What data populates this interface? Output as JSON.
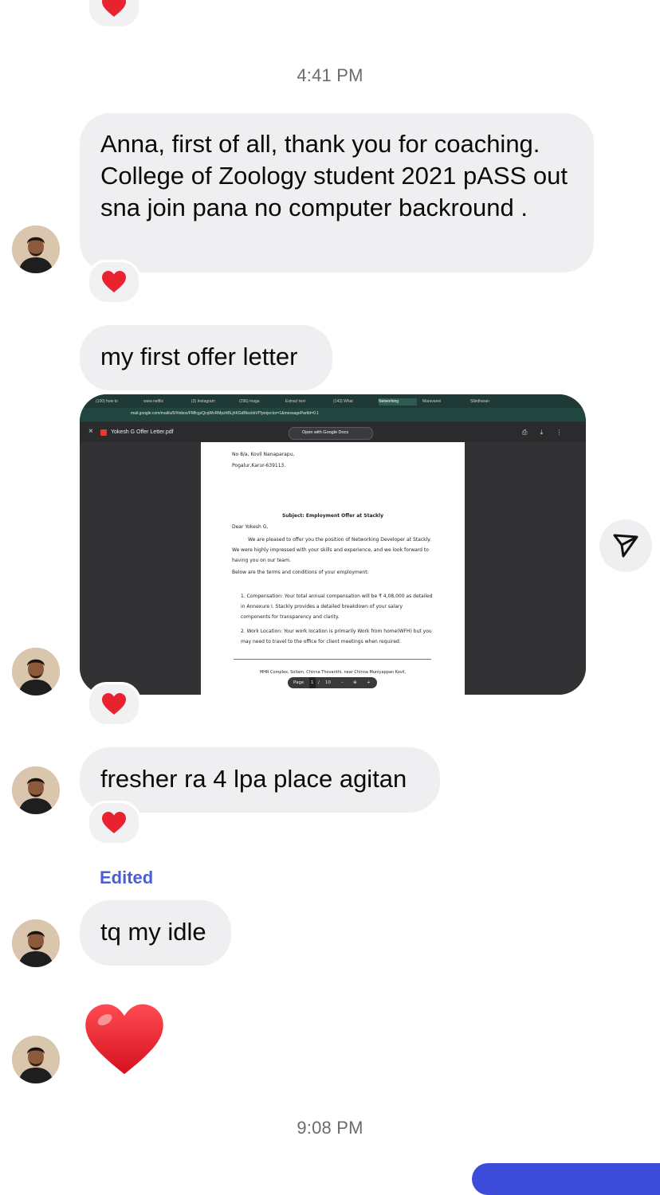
{
  "timestamps": [
    "4:41 PM",
    "9:08 PM"
  ],
  "messages": {
    "coaching": "Anna, first of all, thank you for coaching. College of Zoology student 2021 pASS out sna join pana no computer backround .",
    "offer": "my first offer letter",
    "fresher": "fresher ra 4 lpa place agitan",
    "edited_label": "Edited",
    "tq": "tq my idle"
  },
  "reaction_icon": "red-heart",
  "screenshot": {
    "url": "mail.google.com/mail/u/0/#inbox/FMfcgzQcqWvRMpzhBLjhKGdlNsckbVf?projector=1&messagePartId=0.1",
    "file_name": "Yokesh G Offer Letter.pdf",
    "open_with": "Open with Google Docs",
    "address_1": "No 8/a, Kovil Nanaparapu,",
    "address_2": "Pogalur,Karur-639113.",
    "subject": "Subject: Employment Offer at Stackly",
    "greeting": "Dear Yokesh G,",
    "para_1": "We are pleased to offer you the position of Networking Developer at Stackly. We were highly impressed with your skills and experience, and we look forward to having you on our team.",
    "para_2": "Below are the terms and conditions of your employment:",
    "item_1": "1. Compensation: Your total annual compensation will be ₹ 4,08,000 as detailed in Annexure I. Stackly provides a detailed breakdown of your salary components for transparency and clarity.",
    "item_2": "2. Work Location: Your work location is primarily Work from home(WFH) but you may need to travel to the office for client meetings when required.",
    "footer": "MHR Complex, Sollam, Chinna Thovanthi, near Chinna Muniyappan Kovil,",
    "page_label": "Page",
    "page_current": "1",
    "page_total": "10",
    "tabs": [
      "(100) how to",
      "www.netflix",
      "(3) Instagram",
      "(296) maga",
      "Extract text",
      "(143) What",
      "Networking",
      "Maravanei",
      "Sibidharan"
    ]
  },
  "colors": {
    "bubble": "#efeff1",
    "heart": "#e8232f",
    "edited": "#4a5fd1",
    "accent": "#3c4bd9"
  }
}
